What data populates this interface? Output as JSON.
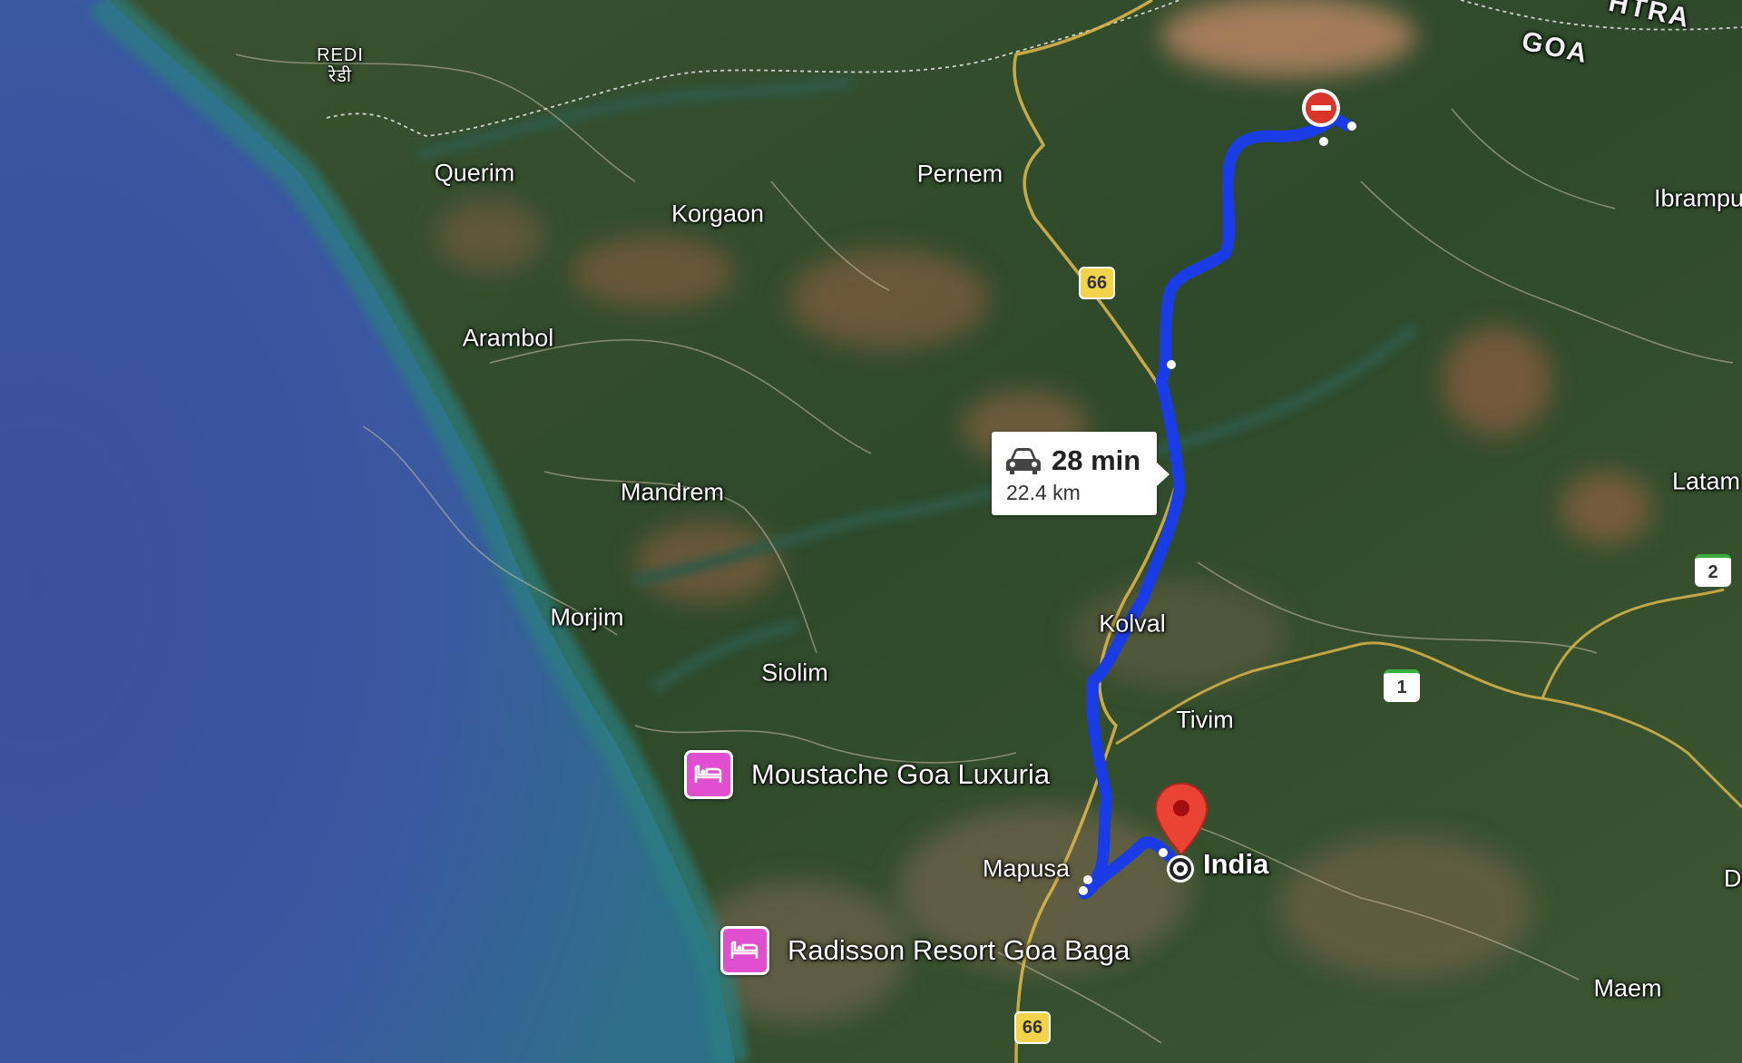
{
  "map": {
    "type": "satellite",
    "route": {
      "mode": "driving",
      "duration": "28 min",
      "distance": "22.4 km",
      "color": "#1a3cf0"
    },
    "destination": {
      "label": "India",
      "icon": "red-pin-icon"
    },
    "origin": {
      "icon": "no-entry-icon"
    },
    "places": [
      {
        "id": "redi",
        "name": "REDI\nरेडी"
      },
      {
        "id": "querim",
        "name": "Querim"
      },
      {
        "id": "korgaon",
        "name": "Korgaon"
      },
      {
        "id": "pernem",
        "name": "Pernem"
      },
      {
        "id": "arambol",
        "name": "Arambol"
      },
      {
        "id": "mandrem",
        "name": "Mandrem"
      },
      {
        "id": "morjim",
        "name": "Morjim"
      },
      {
        "id": "siolim",
        "name": "Siolim"
      },
      {
        "id": "kolval",
        "name": "Kolval"
      },
      {
        "id": "tivim",
        "name": "Tivim"
      },
      {
        "id": "mapusa",
        "name": "Mapusa"
      },
      {
        "id": "ibrampur",
        "name": "Ibrampu"
      },
      {
        "id": "latam",
        "name": "Latam"
      },
      {
        "id": "maem",
        "name": "Maem"
      },
      {
        "id": "d",
        "name": "D"
      },
      {
        "id": "goa",
        "name": "GOA"
      },
      {
        "id": "htra",
        "name": "HTRA"
      }
    ],
    "hotels": [
      {
        "name": "Moustache Goa Luxuria",
        "icon": "hotel-bed-icon"
      },
      {
        "name": "Radisson Resort Goa Baga",
        "icon": "hotel-bed-icon"
      }
    ],
    "road_shields": [
      {
        "text": "66",
        "type": "national-highway"
      },
      {
        "text": "66",
        "type": "national-highway"
      },
      {
        "text": "1",
        "type": "state-highway"
      },
      {
        "text": "2",
        "type": "state-highway"
      }
    ]
  }
}
